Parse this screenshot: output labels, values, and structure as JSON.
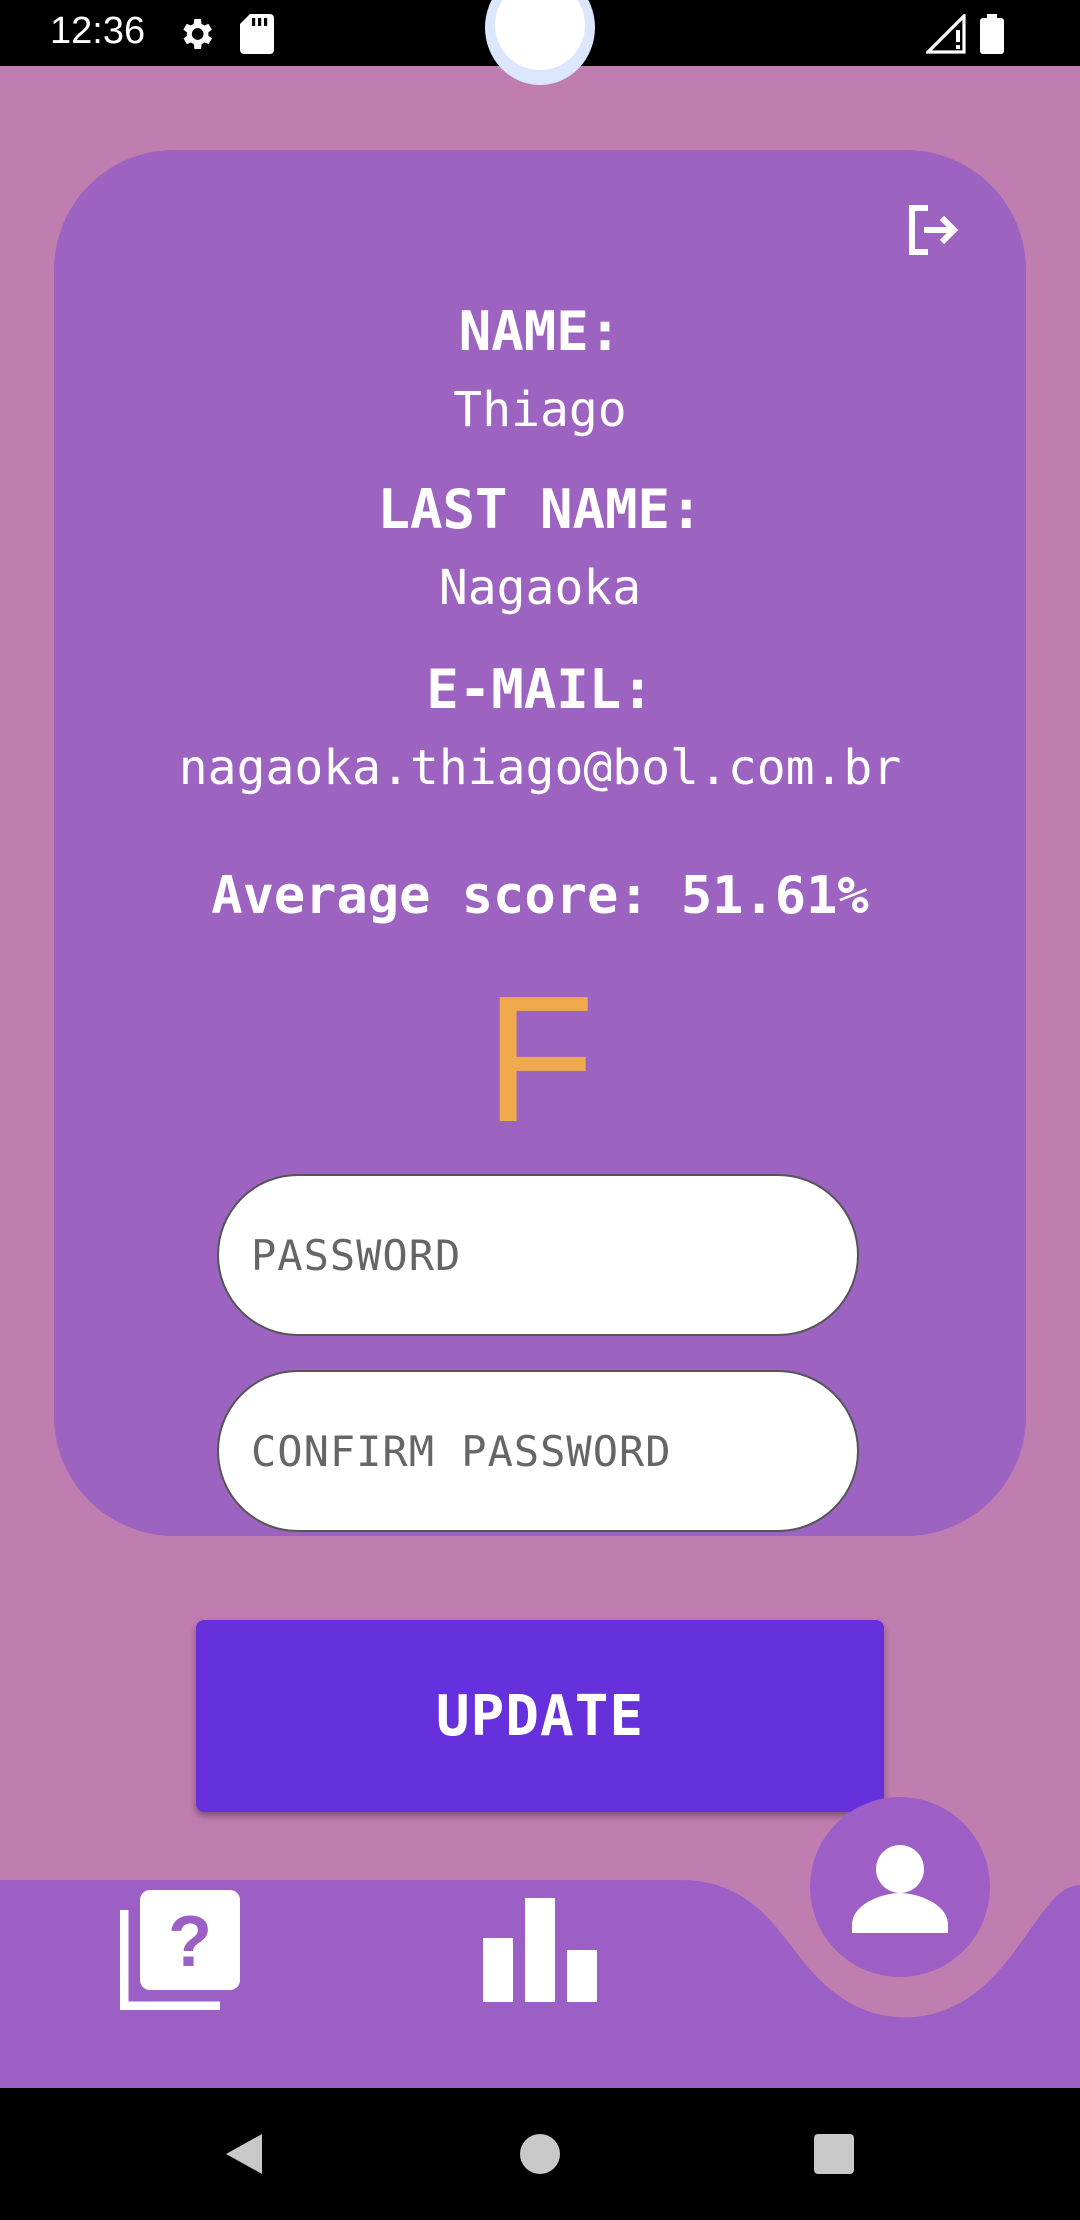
{
  "status": {
    "time": "12:36"
  },
  "profile": {
    "name_label": "NAME:",
    "name_value": "Thiago",
    "lastname_label": "LAST NAME:",
    "lastname_value": "Nagaoka",
    "email_label": "E-MAIL:",
    "email_value": "nagaoka.thiago@bol.com.br",
    "score_text": "Average score: 51.61%",
    "grade": "F"
  },
  "form": {
    "password_placeholder": "PASSWORD",
    "confirm_placeholder": "CONFIRM PASSWORD",
    "update_label": "UPDATE"
  },
  "colors": {
    "background": "#c07eb0",
    "card": "#9c63c1",
    "button": "#6631dc",
    "grade": "#f1a94e"
  },
  "nav": {
    "items": [
      {
        "icon": "quiz-icon"
      },
      {
        "icon": "bar-chart-icon"
      },
      {
        "icon": "person-icon",
        "active": true
      }
    ]
  }
}
